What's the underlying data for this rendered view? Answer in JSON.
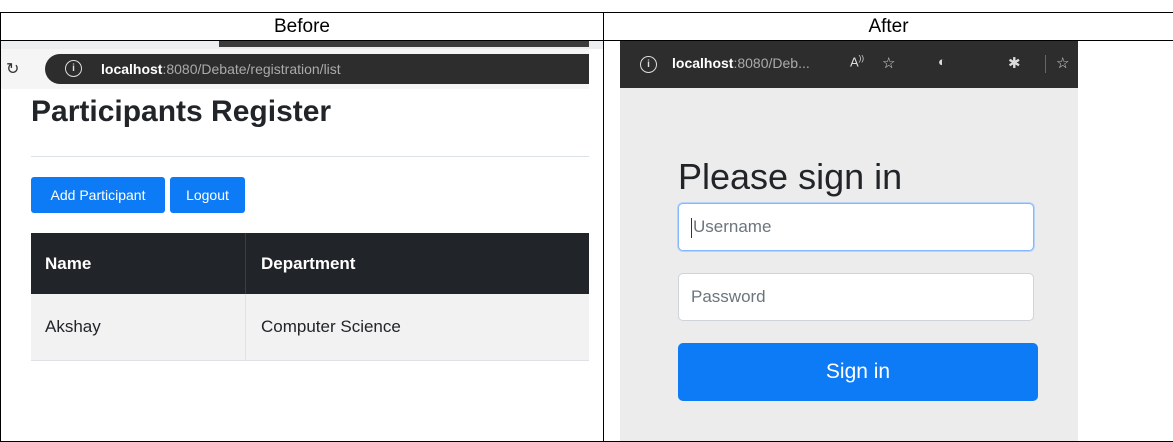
{
  "headers": {
    "before": "Before",
    "after": "After"
  },
  "before": {
    "url_host": "localhost",
    "url_rest": ":8080/Debate/registration/list",
    "page_title": "Participants Register",
    "buttons": {
      "add": "Add Participant",
      "logout": "Logout"
    },
    "table": {
      "columns": [
        "Name",
        "Department"
      ],
      "rows": [
        [
          "Akshay",
          "Computer Science"
        ]
      ]
    }
  },
  "after": {
    "url_host": "localhost",
    "url_rest": ":8080/Deb...",
    "page_title": "Please sign in",
    "username_placeholder": "Username",
    "password_placeholder": "Password",
    "signin_label": "Sign in"
  },
  "colors": {
    "primary": "#0d7bf5",
    "table_header": "#212529",
    "login_bg": "#ececec"
  },
  "icons": [
    "reload-icon",
    "info-icon",
    "read-aloud-icon",
    "favorite-add-icon",
    "extension-icon",
    "puzzle-icon",
    "favorites-icon"
  ]
}
